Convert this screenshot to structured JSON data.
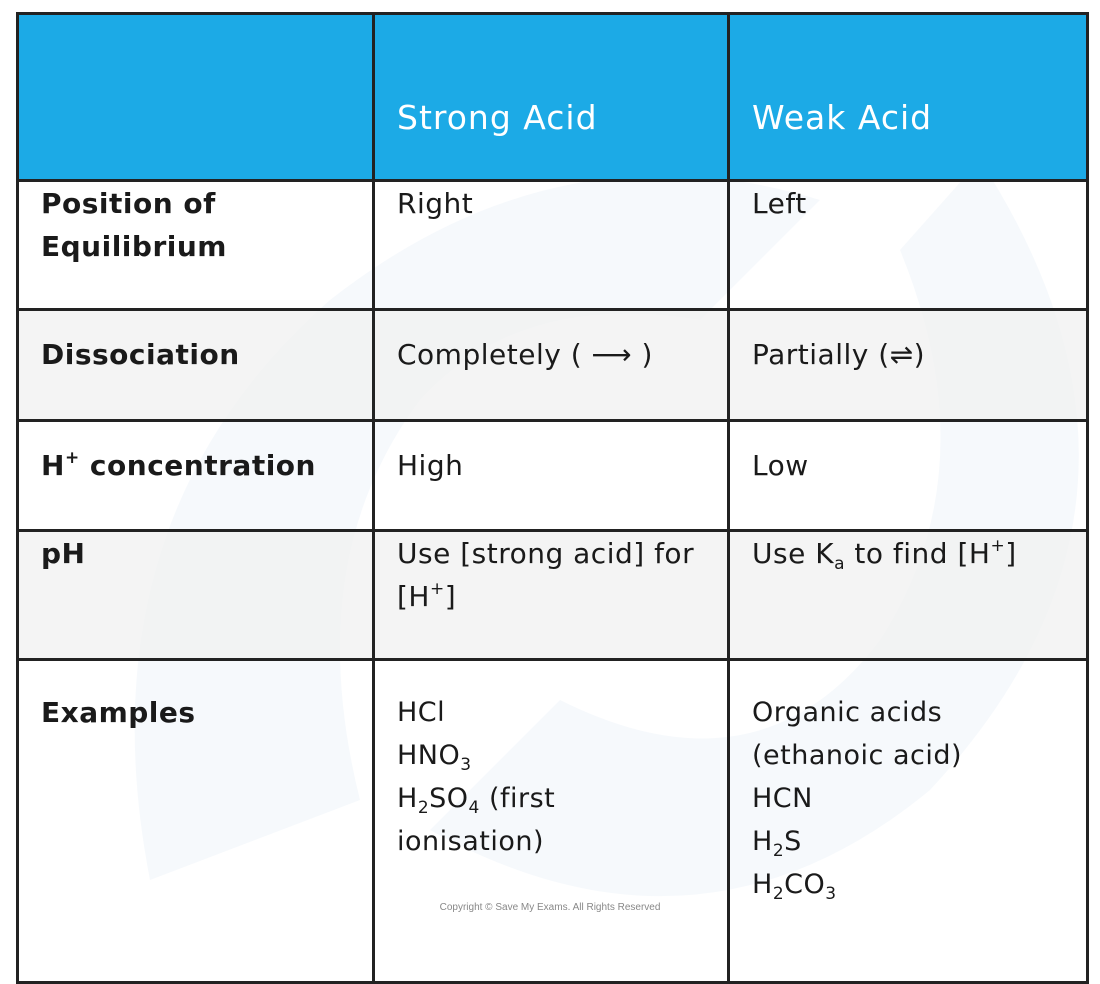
{
  "table": {
    "headers": [
      "",
      "Strong Acid",
      "Weak Acid"
    ],
    "rows": [
      {
        "label": "Position of Equilibrium",
        "strong": "Right",
        "weak": "Left"
      },
      {
        "label": "Dissociation",
        "strong": "Completely ( ⟶ )",
        "weak": "Partially (⇌)"
      },
      {
        "label_main": "H",
        "label_sup": "+",
        "label_rest": " concentration",
        "strong": "High",
        "weak": "Low"
      },
      {
        "label": "pH",
        "strong_a": "Use [strong acid] for [H",
        "strong_sup": "+",
        "strong_b": "]",
        "weak_a": "Use K",
        "weak_sub": "a",
        "weak_b": " to find [H",
        "weak_sup": "+",
        "weak_c": "]"
      },
      {
        "label": "Examples",
        "strong": [
          {
            "a": "HCl"
          },
          {
            "a": "HNO",
            "sub1": "3"
          },
          {
            "a": "H",
            "sub1": "2",
            "b": "SO",
            "sub2": "4",
            "c": "  (first ionisation)"
          }
        ],
        "weak": [
          {
            "a": "Organic acids (ethanoic acid)"
          },
          {
            "a": "HCN"
          },
          {
            "a": "H",
            "sub1": "2",
            "b": "S"
          },
          {
            "a": "H",
            "sub1": "2",
            "b": "CO",
            "sub2": "3"
          }
        ]
      }
    ]
  },
  "colors": {
    "header_bg": "#1caae6",
    "header_text": "#ffffff",
    "border": "#222222"
  },
  "footer": "Copyright © Save My Exams. All Rights Reserved"
}
